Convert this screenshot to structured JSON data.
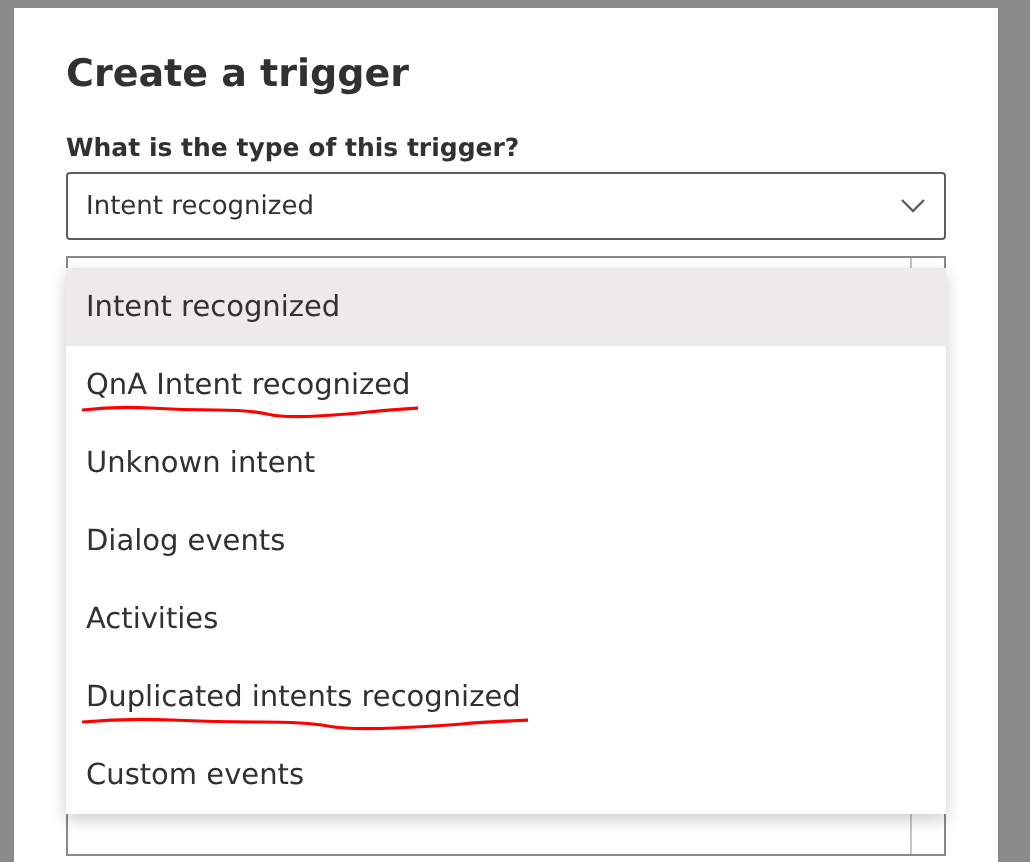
{
  "dialog": {
    "title": "Create a trigger",
    "field_label": "What is the type of this trigger?",
    "dropdown": {
      "value": "Intent recognized",
      "expanded": true
    },
    "options": [
      {
        "label": "Intent recognized",
        "selected": true,
        "underlined": false
      },
      {
        "label": "QnA Intent recognized",
        "selected": false,
        "underlined": true
      },
      {
        "label": "Unknown intent",
        "selected": false,
        "underlined": false
      },
      {
        "label": "Dialog events",
        "selected": false,
        "underlined": false
      },
      {
        "label": "Activities",
        "selected": false,
        "underlined": false
      },
      {
        "label": "Duplicated intents recognized",
        "selected": false,
        "underlined": true
      },
      {
        "label": "Custom events",
        "selected": false,
        "underlined": false
      }
    ]
  }
}
